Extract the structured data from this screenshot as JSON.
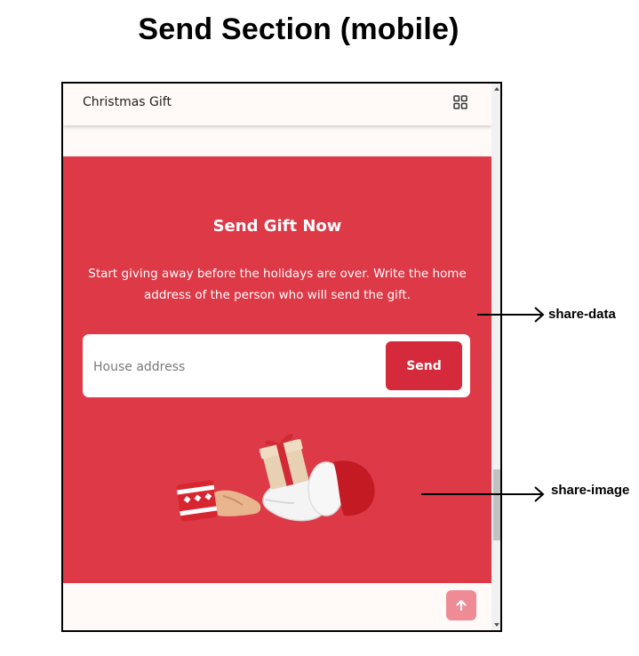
{
  "page": {
    "heading": "Send Section (mobile)"
  },
  "navbar": {
    "brand": "Christmas Gift",
    "menu_icon": "grid-menu-icon"
  },
  "send_section": {
    "title": "Send Gift Now",
    "description": "Start giving away before the holidays are over. Write the home address of the person who will send the gift.",
    "form": {
      "address_placeholder": "House address",
      "address_value": "",
      "send_label": "Send"
    },
    "image_icon": "gift-handover-illustration"
  },
  "back_to_top": {
    "icon": "arrow-up-icon"
  },
  "annotations": [
    {
      "label": "share-data"
    },
    {
      "label": "share-image"
    }
  ],
  "colors": {
    "section_bg": "#dd3947",
    "send_button": "#d42a3c",
    "page_bg": "#fffaf8",
    "back_to_top": "#ee8b95"
  }
}
